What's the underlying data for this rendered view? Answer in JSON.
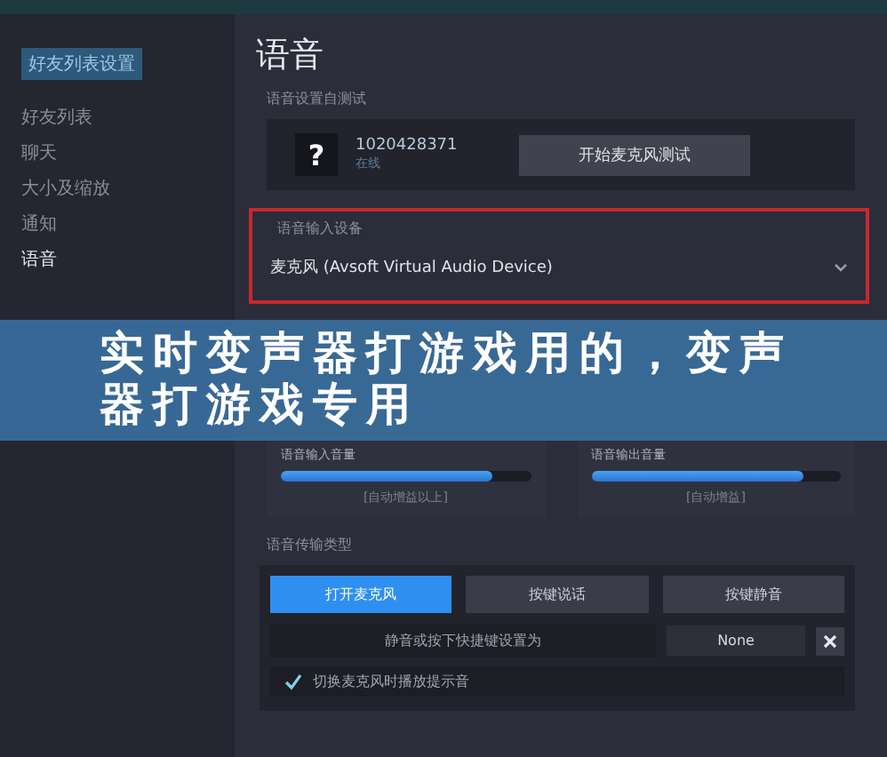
{
  "sidebar": {
    "header": "好友列表设置",
    "items": [
      {
        "label": "好友列表",
        "selected": false
      },
      {
        "label": "聊天",
        "selected": false
      },
      {
        "label": "大小及缩放",
        "selected": false
      },
      {
        "label": "通知",
        "selected": false
      },
      {
        "label": "语音",
        "selected": true
      }
    ]
  },
  "page": {
    "title": "语音"
  },
  "mic_test": {
    "label": "语音设置自测试",
    "avatar": "?",
    "user_id": "1020428371",
    "status": "在线",
    "button": "开始麦克风测试"
  },
  "input_device": {
    "label": "语音输入设备",
    "value": "麦克风 (Avsoft Virtual Audio Device)",
    "highlighted": true
  },
  "volumes": [
    {
      "name": "语音输入音量",
      "level": 0.85,
      "reading": "[自动增益以上]"
    },
    {
      "name": "语音输出音量",
      "level": 0.85,
      "reading": "[自动增益]"
    }
  ],
  "transmission": {
    "label": "语音传输类型",
    "modes": [
      {
        "label": "打开麦克风",
        "selected": true
      },
      {
        "label": "按键说话",
        "selected": false
      },
      {
        "label": "按键静音",
        "selected": false
      }
    ],
    "hotkey_label": "静音或按下快捷键设置为",
    "hotkey_value": "None",
    "checkbox": {
      "label": "切换麦克风时播放提示音",
      "checked": true
    }
  },
  "banner": {
    "text": "实时变声器打游戏用的，变声器打游戏专用"
  }
}
